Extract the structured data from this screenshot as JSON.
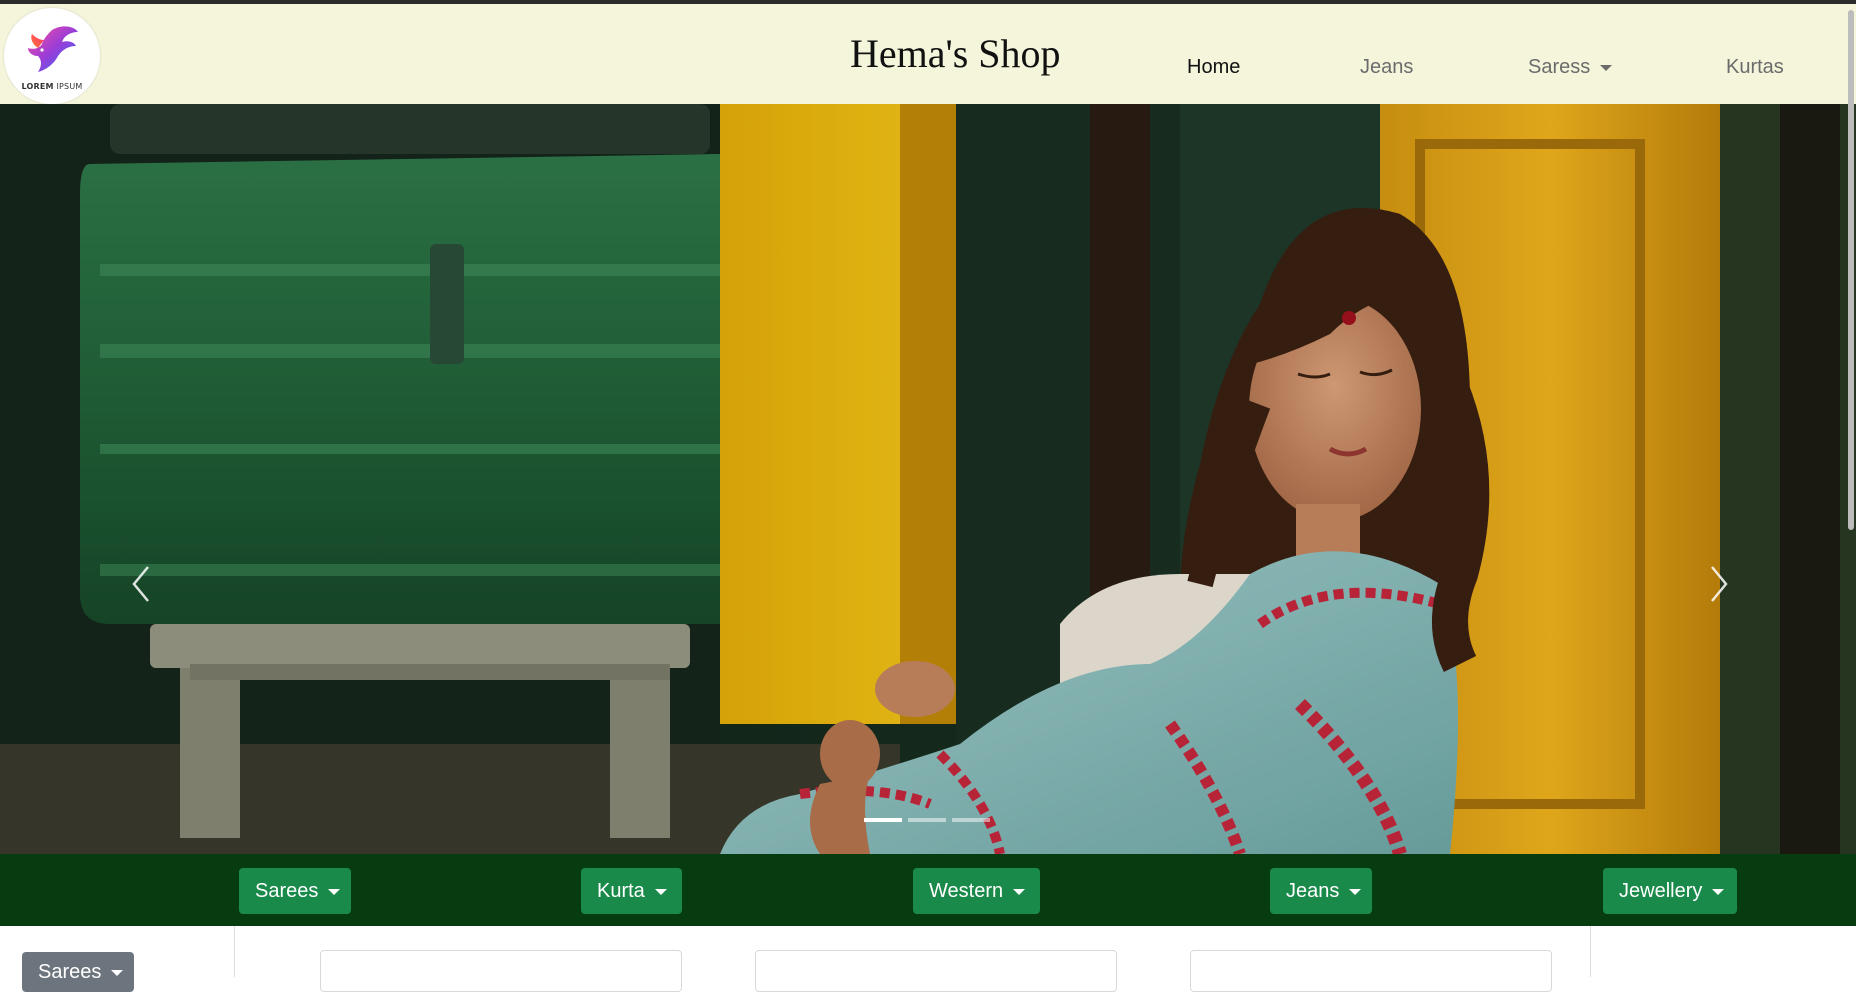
{
  "navbar": {
    "logo_text_bold": "LOREM",
    "logo_text_rest": " IPSUM",
    "brand": "Hema's Shop",
    "links": [
      {
        "label": "Home",
        "active": true,
        "dropdown": false
      },
      {
        "label": "Jeans",
        "active": false,
        "dropdown": false
      },
      {
        "label": "Saress",
        "active": false,
        "dropdown": true
      },
      {
        "label": "Kurtas",
        "active": false,
        "dropdown": false
      }
    ]
  },
  "carousel": {
    "slide_count": 3,
    "active_slide": 1,
    "prev_icon": "chevron-left-icon",
    "next_icon": "chevron-right-icon"
  },
  "categories": [
    {
      "label": "Sarees"
    },
    {
      "label": "Kurta"
    },
    {
      "label": "Western"
    },
    {
      "label": "Jeans"
    },
    {
      "label": "Jewellery"
    }
  ],
  "sidebar": {
    "filter_label": "Sarees"
  },
  "colors": {
    "navbar_bg": "#f5f5dc",
    "category_bar_bg": "#073b10",
    "category_button": "#1a8a4a",
    "sidebar_button": "#6c757d"
  }
}
